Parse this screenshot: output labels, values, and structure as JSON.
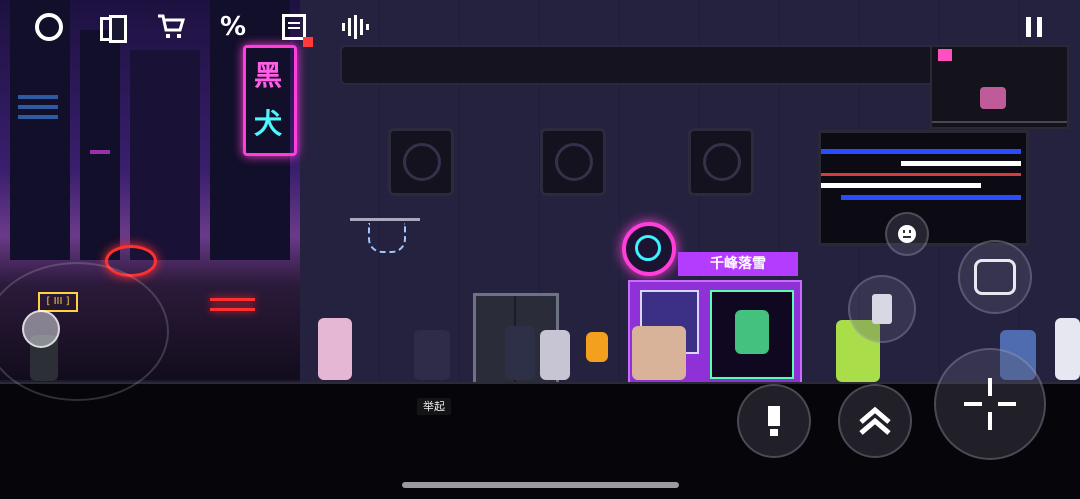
{
  "hud": {
    "top_icons": [
      "circle-menu-icon",
      "cards-icon",
      "shop-cart-icon",
      "percent-discount-icon",
      "calendar-gift-icon",
      "voice-icon"
    ],
    "pause_icon": "pause-icon",
    "gift_icon": "gift-icon"
  },
  "signs": {
    "neon_glyph_1": "黑",
    "neon_glyph_2": "犬",
    "shop_name": "千峰落雪",
    "small_sign": "[ III ]"
  },
  "controls": {
    "joystick": "movement-joystick",
    "emote_icon": "smile-icon",
    "skill_icon": "skill-icon",
    "interact_icon": "interact-icon",
    "jump_icon": "double-chevron-up-icon",
    "aim_icon": "crosshair-icon"
  },
  "tooltip": {
    "label": "举起"
  },
  "colors": {
    "neon_pink": "#ff3fd8",
    "neon_cyan": "#3ff2ff",
    "neon_green": "#7dff4a",
    "neon_red": "#ff3030",
    "neon_purple": "#b43cff"
  }
}
